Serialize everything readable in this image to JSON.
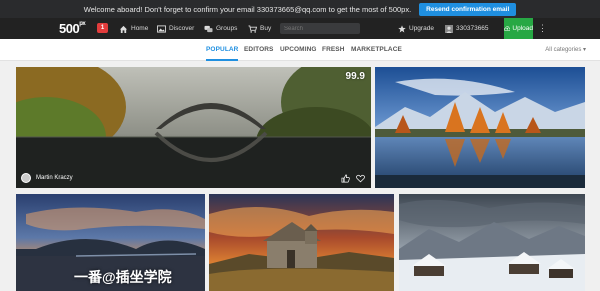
{
  "notification": {
    "message": "Welcome aboard! Don't forget to confirm your email 330373665@qq.com to get the most of 500px.",
    "button": "Resend confirmation email"
  },
  "nav": {
    "logo": "500",
    "logo_sup": "px",
    "badge_count": "1",
    "items": [
      {
        "label": "Home",
        "icon": "home-icon"
      },
      {
        "label": "Discover",
        "icon": "image-icon"
      },
      {
        "label": "Groups",
        "icon": "groups-icon"
      },
      {
        "label": "Buy",
        "icon": "cart-icon"
      }
    ],
    "search_placeholder": "Search",
    "upgrade": "Upgrade",
    "username": "330373665",
    "upload": "Upload",
    "more": "⋮"
  },
  "tabs": [
    "POPULAR",
    "EDITORS",
    "UPCOMING",
    "FRESH",
    "MARKETPLACE"
  ],
  "active_tab": "POPULAR",
  "categories_label": "All categories ▾",
  "photos": [
    {
      "score": "99.9",
      "author": "Martin Kraczy"
    },
    {},
    {
      "watermark": "一番@插坐学院"
    },
    {},
    {}
  ],
  "colors": {
    "accent": "#1f8fe0",
    "upload_green": "#27a844",
    "badge_red": "#e23c3c",
    "nav_bg": "#222222"
  }
}
